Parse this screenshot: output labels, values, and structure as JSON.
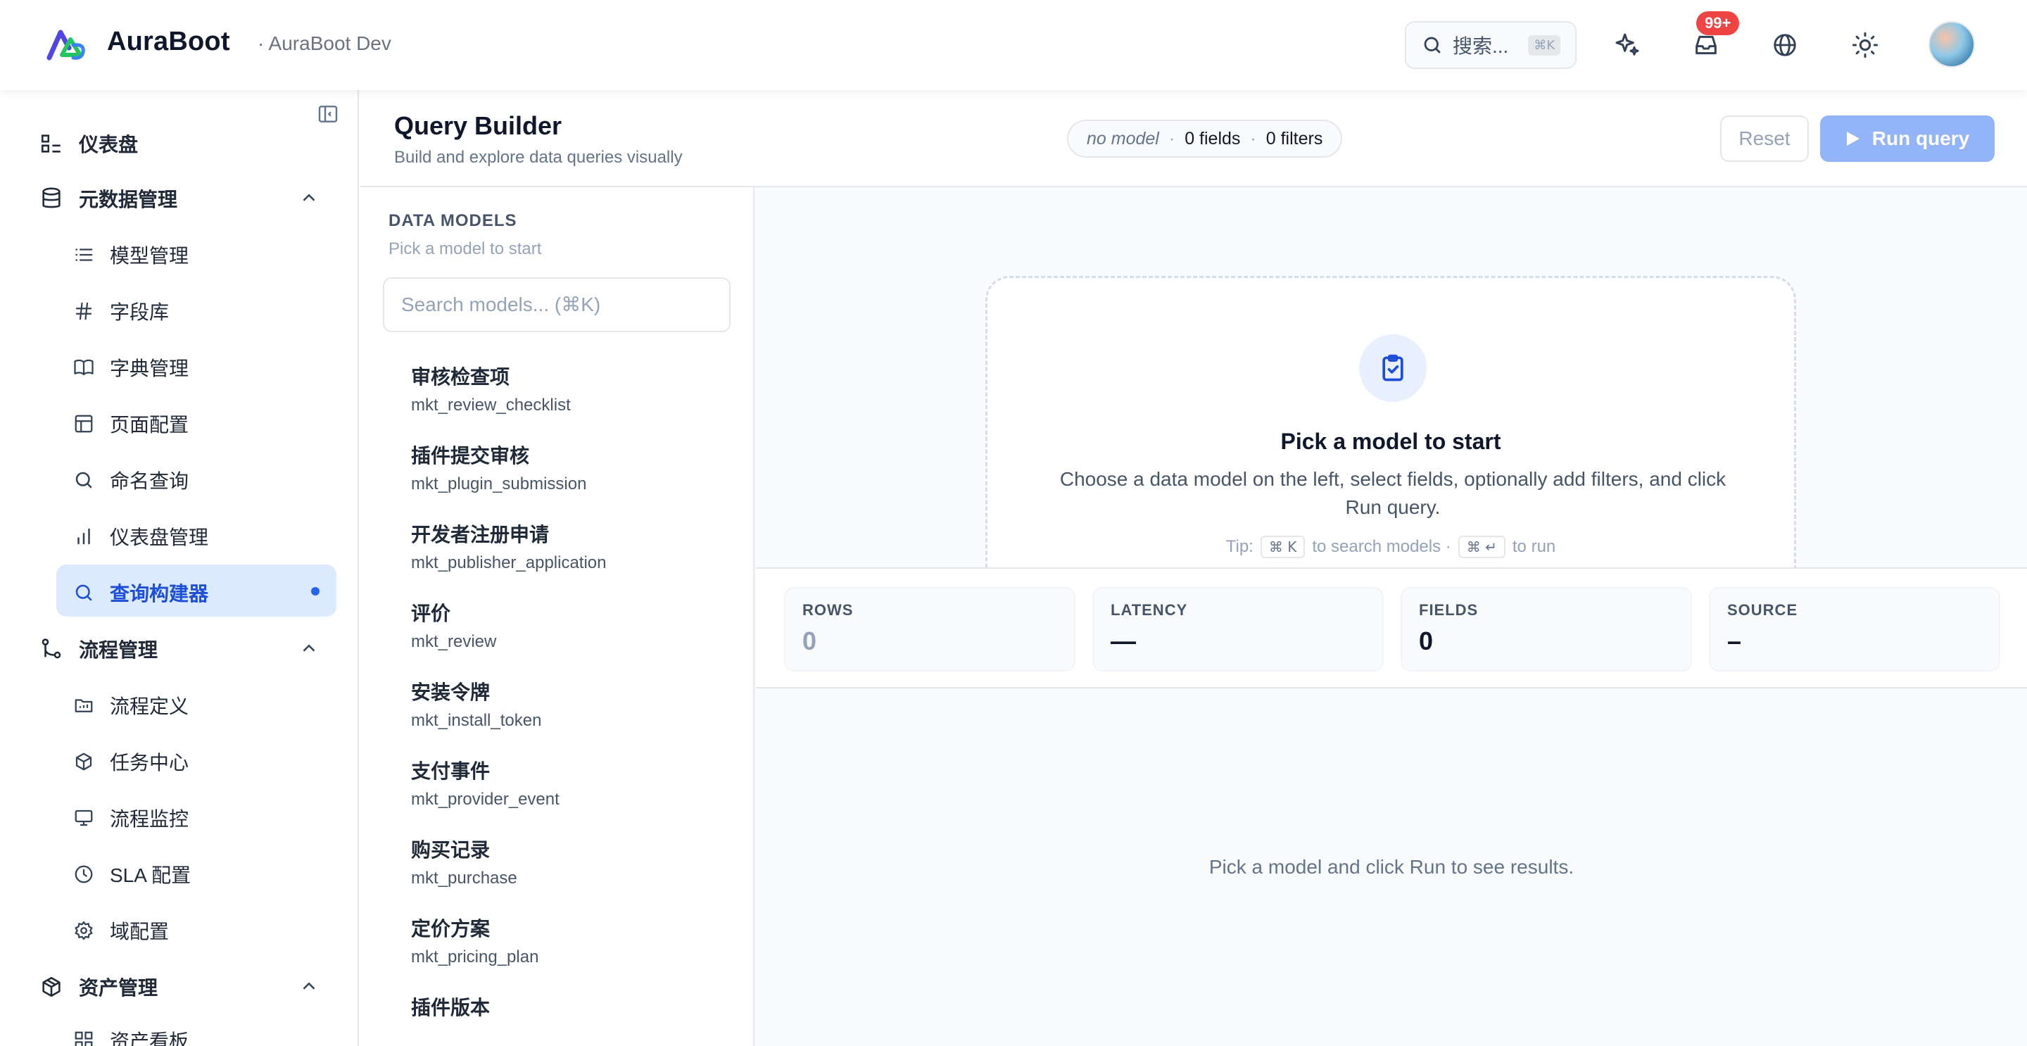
{
  "header": {
    "brand": "AuraBoot",
    "environment": "· AuraBoot Dev",
    "search_label": "搜索...",
    "search_shortcut": "⌘K",
    "notification_count": "99+"
  },
  "sidebar": {
    "items": [
      {
        "label": "仪表盘",
        "icon": "dashboard-icon"
      },
      {
        "label": "元数据管理",
        "icon": "database-icon"
      },
      {
        "label": "模型管理",
        "icon": "list-icon"
      },
      {
        "label": "字段库",
        "icon": "hash-icon"
      },
      {
        "label": "字典管理",
        "icon": "book-icon"
      },
      {
        "label": "页面配置",
        "icon": "layout-icon"
      },
      {
        "label": "命名查询",
        "icon": "search-icon"
      },
      {
        "label": "仪表盘管理",
        "icon": "bar-chart-icon"
      },
      {
        "label": "查询构建器",
        "icon": "search-icon"
      },
      {
        "label": "流程管理",
        "icon": "git-branch-icon"
      },
      {
        "label": "流程定义",
        "icon": "folder-icon"
      },
      {
        "label": "任务中心",
        "icon": "cube-icon"
      },
      {
        "label": "流程监控",
        "icon": "monitor-icon"
      },
      {
        "label": "SLA 配置",
        "icon": "clock-icon"
      },
      {
        "label": "域配置",
        "icon": "settings-icon"
      },
      {
        "label": "资产管理",
        "icon": "package-icon"
      },
      {
        "label": "资产看板",
        "icon": "grid-icon"
      }
    ],
    "active": "查询构建器"
  },
  "page": {
    "title": "Query Builder",
    "subtitle": "Build and explore data queries visually",
    "pill_model": "no model",
    "pill_fields": "0 fields",
    "pill_filters": "0 filters",
    "reset_label": "Reset",
    "run_label": "Run query"
  },
  "models": {
    "heading": "DATA MODELS",
    "subheading": "Pick a model to start",
    "search_placeholder": "Search models... (⌘K)",
    "items": [
      {
        "name": "审核检查项",
        "code": "mkt_review_checklist"
      },
      {
        "name": "插件提交审核",
        "code": "mkt_plugin_submission"
      },
      {
        "name": "开发者注册申请",
        "code": "mkt_publisher_application"
      },
      {
        "name": "评价",
        "code": "mkt_review"
      },
      {
        "name": "安装令牌",
        "code": "mkt_install_token"
      },
      {
        "name": "支付事件",
        "code": "mkt_provider_event"
      },
      {
        "name": "购买记录",
        "code": "mkt_purchase"
      },
      {
        "name": "定价方案",
        "code": "mkt_pricing_plan"
      },
      {
        "name": "插件版本",
        "code": ""
      }
    ]
  },
  "empty_state": {
    "title": "Pick a model to start",
    "description": "Choose a data model on the left, select fields, optionally add filters, and click Run query.",
    "tip_prefix": "Tip:",
    "tip_key1": "⌘ K",
    "tip_mid": "to search models ·",
    "tip_key2": "⌘ ↵",
    "tip_suffix": "to run"
  },
  "stats": [
    {
      "label": "ROWS",
      "value": "0"
    },
    {
      "label": "LATENCY",
      "value": "—"
    },
    {
      "label": "FIELDS",
      "value": "0"
    },
    {
      "label": "SOURCE",
      "value": "–"
    }
  ],
  "results": {
    "empty_message": "Pick a model and click Run to see results."
  },
  "colors": {
    "accent": "#2563eb",
    "active_bg": "#dbeafe",
    "run_button_disabled": "#93b4f9",
    "badge": "#ef4444"
  }
}
